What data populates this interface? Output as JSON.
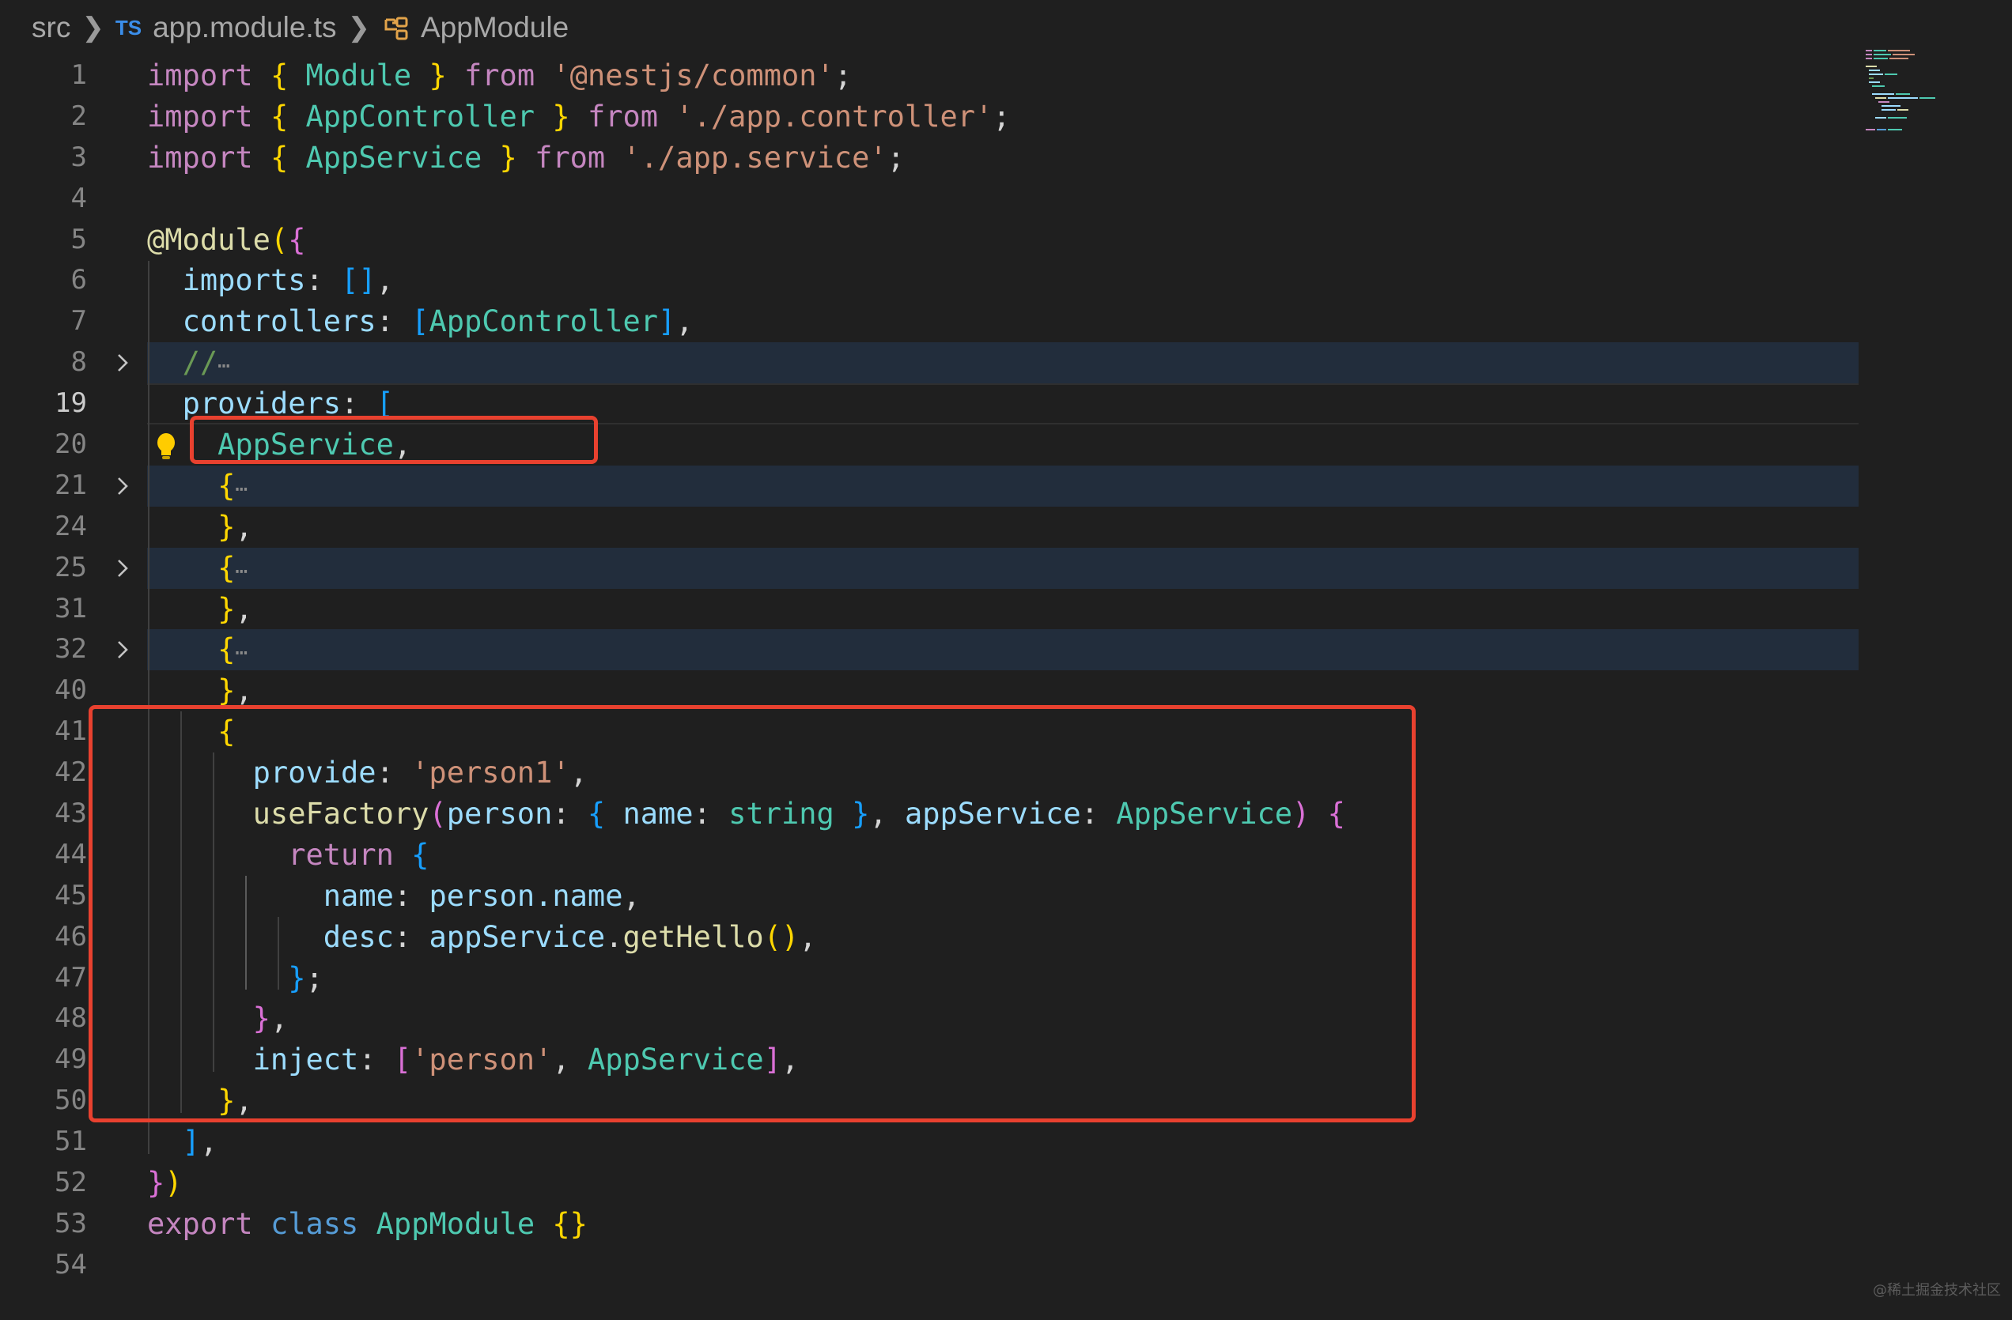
{
  "breadcrumb": {
    "folder": "src",
    "file_badge": "TS",
    "file": "app.module.ts",
    "symbol": "AppModule"
  },
  "line_numbers": [
    "1",
    "2",
    "3",
    "4",
    "5",
    "6",
    "7",
    "8",
    "19",
    "20",
    "21",
    "24",
    "25",
    "31",
    "32",
    "40",
    "41",
    "42",
    "43",
    "44",
    "45",
    "46",
    "47",
    "48",
    "49",
    "50",
    "51",
    "52",
    "53",
    "54"
  ],
  "active_line": "19",
  "code": {
    "kw_import": "import",
    "kw_from": "from",
    "kw_export": "export",
    "kw_class": "class",
    "kw_return": "return",
    "lbrace": "{",
    "rbrace": "}",
    "module_name": "Module",
    "module_decorator": "@Module",
    "app_controller": "AppController",
    "app_service": "AppService",
    "app_module": "AppModule",
    "str_nest_common": "'@nestjs/common'",
    "str_app_controller": "'./app.controller'",
    "str_app_service": "'./app.service'",
    "str_person1": "'person1'",
    "str_person": "'person'",
    "prop_imports": "imports",
    "prop_controllers": "controllers",
    "prop_providers": "providers",
    "prop_provide": "provide",
    "prop_name": "name",
    "prop_desc": "desc",
    "prop_inject": "inject",
    "fn_use_factory": "useFactory",
    "fn_get_hello": "getHello",
    "param_person": "person",
    "param_app_service": "appService",
    "type_string": "string",
    "member_person_name": "person.name",
    "comment": "//",
    "fold_ellipsis": "⋯"
  },
  "highlight_color": "#e8412f",
  "watermark": "@稀土掘金技术社区"
}
